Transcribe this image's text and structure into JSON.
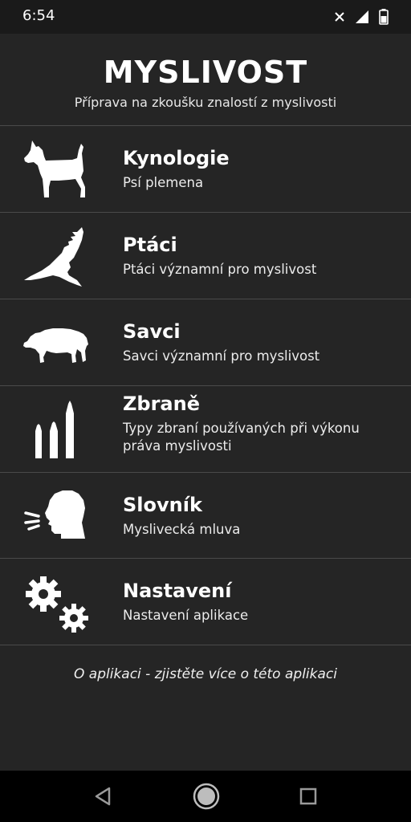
{
  "status_bar": {
    "time": "6:54",
    "icons": [
      "close-icon",
      "signal-icon",
      "battery-icon"
    ]
  },
  "header": {
    "title": "MYSLIVOST",
    "subtitle": "Příprava na zkoušku znalostí z myslivosti"
  },
  "menu": {
    "items": [
      {
        "title": "Kynologie",
        "description": "Psí plemena",
        "icon": "dog-icon"
      },
      {
        "title": "Ptáci",
        "description": "Ptáci významní pro myslivost",
        "icon": "bird-icon"
      },
      {
        "title": "Savci",
        "description": "Savci významní pro myslivost",
        "icon": "boar-icon"
      },
      {
        "title": "Zbraně",
        "description": "Typy zbraní používaných při výkonu práva myslivosti",
        "icon": "bullets-icon"
      },
      {
        "title": "Slovník",
        "description": "Myslivecká mluva",
        "icon": "speaking-head-icon"
      },
      {
        "title": "Nastavení",
        "description": "Nastavení aplikace",
        "icon": "gears-icon"
      }
    ]
  },
  "about_link": "O aplikaci - zjistěte více o této aplikaci",
  "nav_bar": {
    "buttons": [
      "back-icon",
      "home-icon",
      "recents-icon"
    ]
  },
  "colors": {
    "background": "#252525",
    "status_bar": "#1a1a1a",
    "nav_bar": "#000000",
    "divider": "#4a4a4a",
    "text": "#ffffff"
  }
}
